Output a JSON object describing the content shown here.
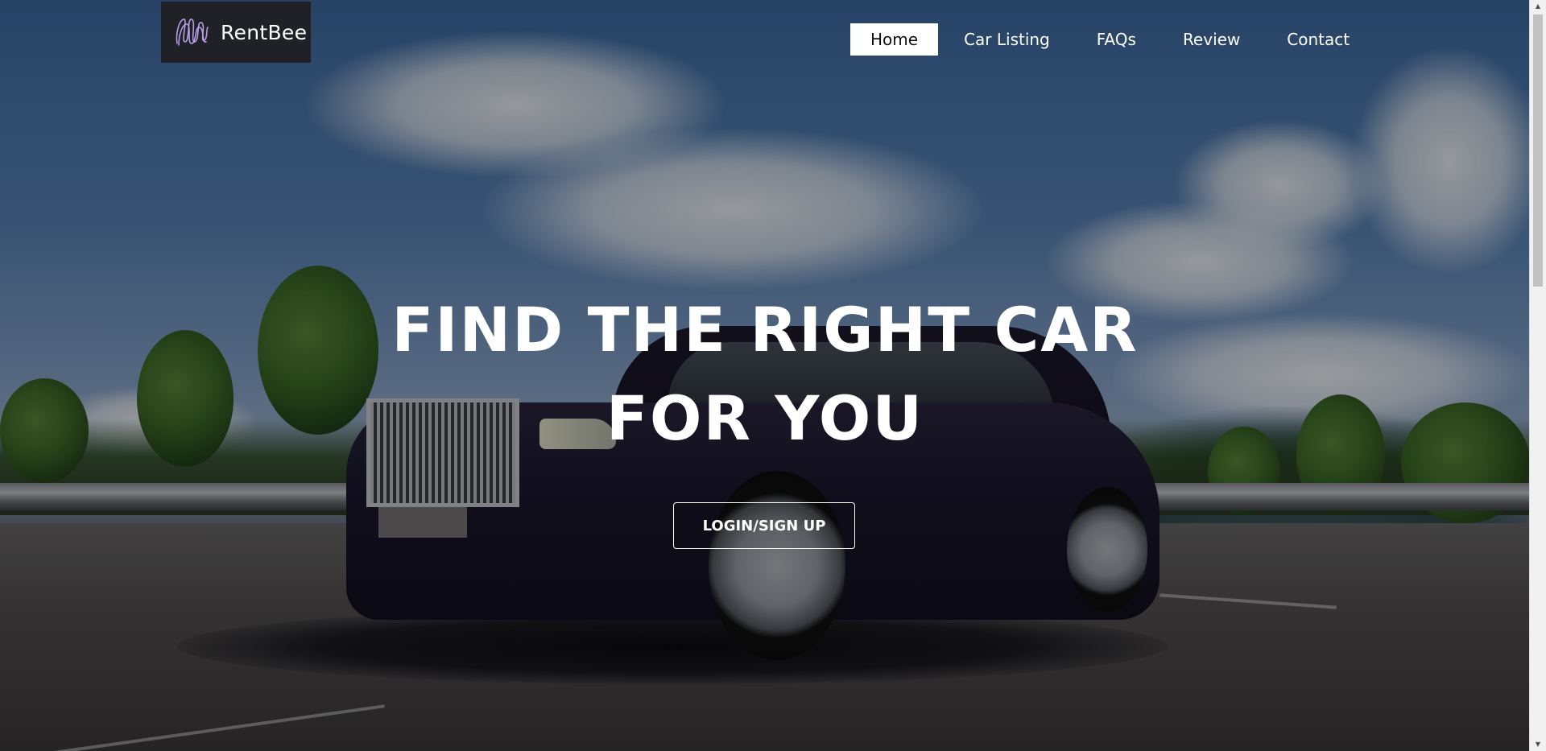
{
  "brand": {
    "name": "RentBee",
    "logo_icon": "scribble-logo-icon",
    "logo_color": "#b79ce6"
  },
  "nav": {
    "items": [
      {
        "label": "Home",
        "active": true
      },
      {
        "label": "Car Listing",
        "active": false
      },
      {
        "label": "FAQs",
        "active": false
      },
      {
        "label": "Review",
        "active": false
      },
      {
        "label": "Contact",
        "active": false
      }
    ]
  },
  "hero": {
    "headline_line1": "FIND THE RIGHT CAR",
    "headline_line2": "FOR YOU",
    "cta_label": "LOGIN/SIGN UP",
    "background_description_icon": "car-photo"
  },
  "scrollbar": {
    "up_icon": "arrow-up-icon",
    "down_icon": "arrow-down-icon"
  }
}
